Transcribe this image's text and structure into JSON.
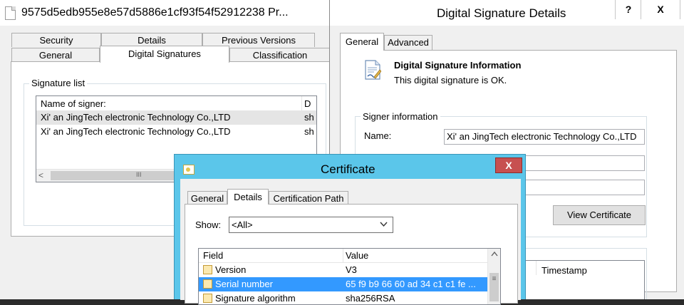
{
  "file_properties": {
    "title": "9575d5edb955e8e57d5886e1cf93f54f52912238 Pr...",
    "tabs_back": [
      "Security",
      "Details",
      "Previous Versions"
    ],
    "tabs_front": [
      "General",
      "Digital Signatures",
      "Classification"
    ],
    "selected_tab": "Digital Signatures",
    "signature_list_label": "Signature list",
    "columns": [
      "Name of signer:",
      "D"
    ],
    "signers": [
      {
        "name": "Xi' an JingTech electronic Technology Co.,LTD",
        "trailing": "sh"
      },
      {
        "name": "Xi' an JingTech electronic Technology Co.,LTD",
        "trailing": "sh"
      }
    ],
    "scroll_left_glyph": "<",
    "scroll_grip_glyph": "III"
  },
  "signature_details": {
    "title": "Digital Signature Details",
    "help_label": "?",
    "close_label": "X",
    "tabs": [
      "General",
      "Advanced"
    ],
    "selected_tab": "General",
    "info_title": "Digital Signature Information",
    "info_status": "This digital signature is OK.",
    "signer_info_label": "Signer information",
    "name_label": "Name:",
    "name_value": "Xi' an JingTech electronic Technology Co.,LTD",
    "view_certificate_label": "View Certificate",
    "timestamp_header": "Timestamp"
  },
  "certificate": {
    "title": "Certificate",
    "close_label": "X",
    "tabs": [
      "General",
      "Details",
      "Certification Path"
    ],
    "selected_tab": "Details",
    "show_label": "Show:",
    "show_value": "<All>",
    "columns": [
      "Field",
      "Value"
    ],
    "rows": [
      {
        "field": "Version",
        "value": "V3"
      },
      {
        "field": "Serial number",
        "value": "65 f9 b9 66 60 ad 34 c1 c1 fe ...",
        "selected": true
      },
      {
        "field": "Signature algorithm",
        "value": "sha256RSA"
      }
    ],
    "scroll_grip_glyph": "≡"
  },
  "colors": {
    "certificate_frame": "#5bc6ea",
    "close_button": "#c75050",
    "selection": "#3399ff",
    "dialog_face": "#f0f0f0"
  },
  "icons": [
    "file-icon",
    "document-signature-icon",
    "certificate-icon",
    "field-icon",
    "dropdown-arrow-icon",
    "scroll-up-icon"
  ]
}
